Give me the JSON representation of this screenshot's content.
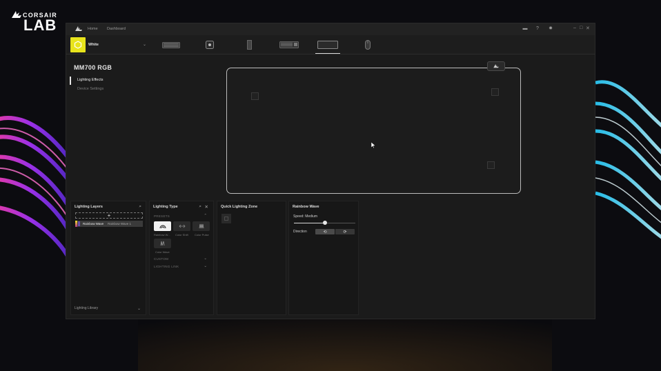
{
  "overlay": {
    "brand_top": "CORSAIR",
    "brand_bottom": "LAB"
  },
  "window": {
    "nav": [
      "Home",
      "Dashboard"
    ],
    "window_controls": [
      "–",
      "□",
      "✕"
    ]
  },
  "profile": {
    "name": "White",
    "swatch_color": "#e8e41c"
  },
  "devices": [
    "keyboard-icon",
    "hub-icon",
    "case-icon",
    "keyboard-full-icon",
    "mousepad-icon",
    "mouse-icon"
  ],
  "active_device": "mousepad-icon",
  "device": {
    "title": "MM700 RGB"
  },
  "sidebar": {
    "items": [
      {
        "label": "Lighting Effects",
        "active": true
      },
      {
        "label": "Device Settings",
        "active": false
      }
    ]
  },
  "layers": {
    "title": "Lighting Layers",
    "add": "+",
    "row": {
      "name": "Rainbow Wave",
      "sub": "Rainbow Wave 1"
    },
    "library": "Lighting Library"
  },
  "lighting_type": {
    "title": "Lighting Type",
    "presets": "PRESETS",
    "effects": [
      {
        "label": "Rainbow W...",
        "selected": true
      },
      {
        "label": "Color Shift",
        "selected": false
      },
      {
        "label": "Color Pulse",
        "selected": false
      },
      {
        "label": "Color Wave",
        "selected": false
      }
    ],
    "custom": "CUSTOM",
    "link": "LIGHTING LINK"
  },
  "quick_zone": {
    "title": "Quick Lighting Zone"
  },
  "rainbow": {
    "title": "Rainbow Wave",
    "speed_label": "Speed: Medium",
    "speed_value": 0.5,
    "direction_label": "Direction",
    "directions": [
      "⟲",
      "⟳"
    ],
    "active_direction": 0
  }
}
